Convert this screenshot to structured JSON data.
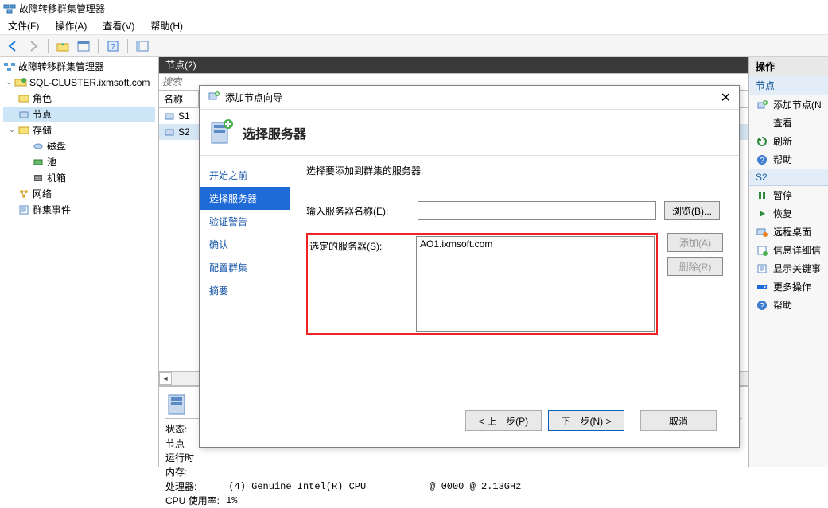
{
  "window": {
    "title": "故障转移群集管理器"
  },
  "menu": {
    "file": "文件(F)",
    "action": "操作(A)",
    "view": "查看(V)",
    "help": "帮助(H)"
  },
  "tree": {
    "root": "故障转移群集管理器",
    "cluster": "SQL-CLUSTER.ixmsoft.com",
    "roles": "角色",
    "nodes": "节点",
    "storage": "存储",
    "disks": "磁盘",
    "pools": "池",
    "enclosure": "机箱",
    "networks": "网络",
    "events": "群集事件"
  },
  "center": {
    "nodesHeader": "节点(2)",
    "searchPlaceholder": "搜索",
    "colName": "名称",
    "row1": "S1",
    "row2": "S2"
  },
  "detail": {
    "status": "状态:",
    "node": "节点",
    "runtime": "运行时",
    "memory": "内存:",
    "cpuLabel": "处理器:",
    "cpuVal1": "(4) Genuine Intel(R) CPU",
    "cpuVal2": "@ 0000 @ 2.13GHz",
    "cpuUsage": "CPU 使用率:",
    "cpuUsageVal": "1%"
  },
  "actions": {
    "paneTitle": "操作",
    "sect1": "节点",
    "addNode": "添加节点(N",
    "view": "查看",
    "refresh": "刷新",
    "help1": "帮助",
    "sect2": "S2",
    "pause": "暂停",
    "resume": "恢复",
    "remoteDesktop": "远程桌面",
    "infoDetail": "信息详细信",
    "showCritical": "显示关键事",
    "moreActions": "更多操作",
    "help2": "帮助"
  },
  "wizard": {
    "title": "添加节点向导",
    "banner": "选择服务器",
    "steps": {
      "before": "开始之前",
      "selectServer": "选择服务器",
      "validateWarn": "验证警告",
      "confirm": "确认",
      "configCluster": "配置群集",
      "summary": "摘要"
    },
    "instruction": "选择要添加到群集的服务器:",
    "serverNameLabel": "输入服务器名称(E):",
    "serverNameValue": "",
    "selectedLabel": "选定的服务器(S):",
    "selectedValue": "AO1.ixmsoft.com",
    "browse": "浏览(B)...",
    "add": "添加(A)",
    "remove": "删除(R)",
    "back": "< 上一步(P)",
    "next": "下一步(N) >",
    "cancel": "取消"
  }
}
